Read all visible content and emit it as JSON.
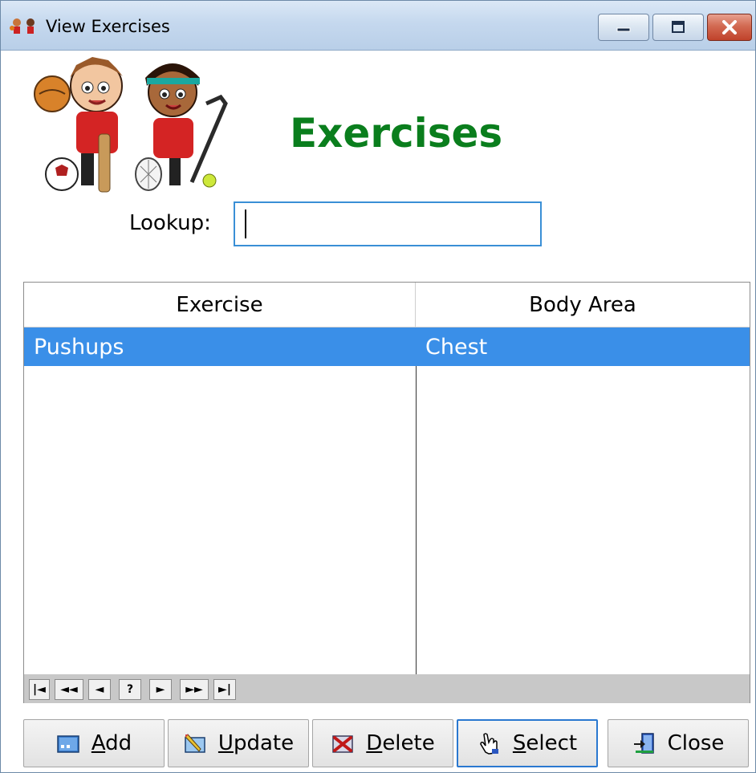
{
  "window": {
    "title": "View Exercises"
  },
  "header": {
    "title": "Exercises",
    "title_color": "#0a7e1d"
  },
  "lookup": {
    "label": "Lookup:",
    "value": "",
    "placeholder": ""
  },
  "grid": {
    "columns": [
      "Exercise",
      "Body Area"
    ],
    "rows": [
      {
        "exercise": "Pushups",
        "body_area": "Chest",
        "selected": true
      }
    ],
    "selection_color": "#3a8fe8",
    "nav": [
      "|◄",
      "◄◄",
      "◄",
      "?",
      "►",
      "►►",
      "►|"
    ]
  },
  "buttons": {
    "add": {
      "pre": "",
      "accel": "A",
      "post": "dd"
    },
    "update": {
      "pre": "",
      "accel": "U",
      "post": "pdate"
    },
    "delete": {
      "pre": "",
      "accel": "D",
      "post": "elete"
    },
    "select": {
      "pre": "",
      "accel": "S",
      "post": "elect"
    },
    "close": {
      "pre": "Close",
      "accel": "",
      "post": ""
    }
  },
  "icons": {
    "app": "kids-sports-icon",
    "add": "add-form-icon",
    "update": "edit-pencil-icon",
    "delete": "delete-x-icon",
    "select": "hand-pointer-icon",
    "close": "exit-door-icon"
  }
}
